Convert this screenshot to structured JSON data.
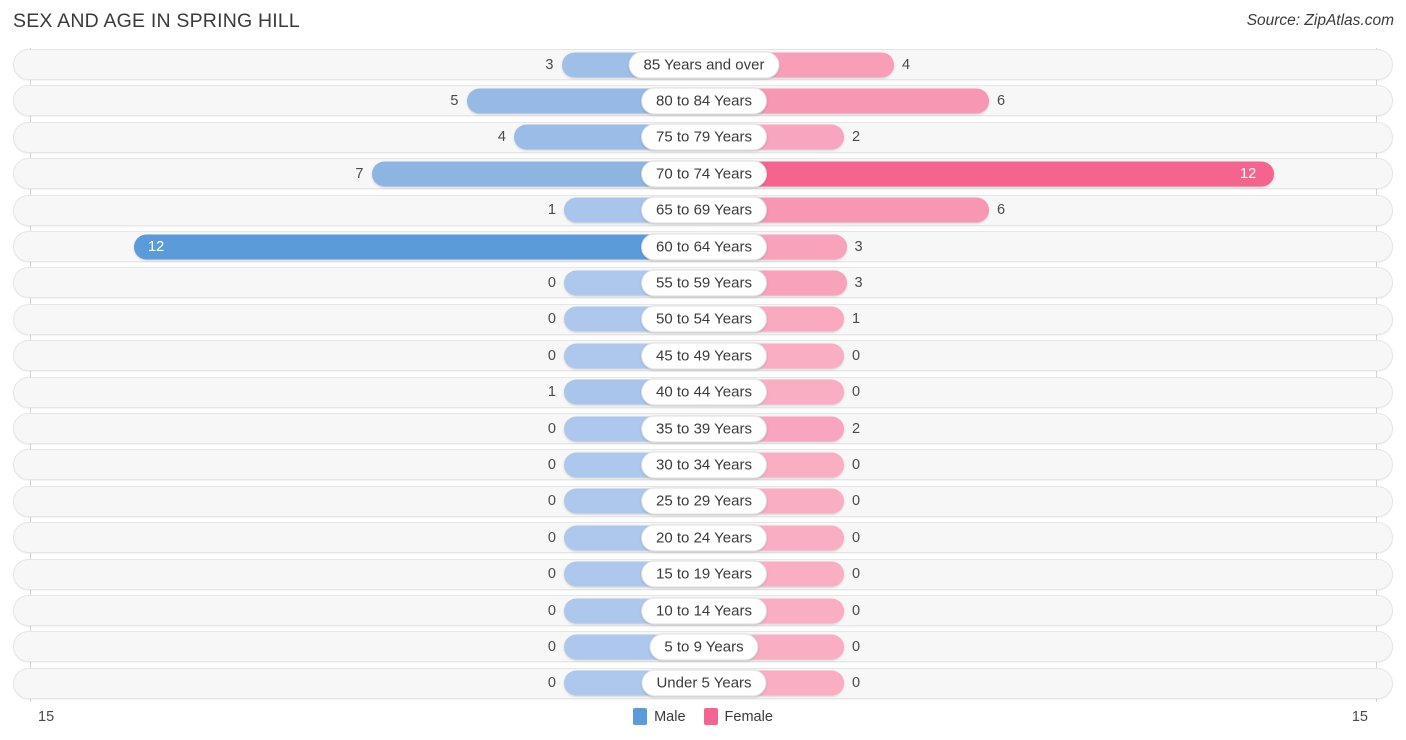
{
  "header": {
    "title": "SEX AND AGE IN SPRING HILL",
    "source": "Source: ZipAtlas.com"
  },
  "legend": {
    "male_label": "Male",
    "female_label": "Female",
    "male_color": "#5b9bd9",
    "female_color": "#f4648f"
  },
  "axis": {
    "left_label": "15",
    "right_label": "15",
    "max": 15
  },
  "chart_data": {
    "type": "bar",
    "title": "SEX AND AGE IN SPRING HILL",
    "subtitle": "Source: ZipAtlas.com",
    "orientation": "horizontal",
    "layout": "population-pyramid",
    "xlabel": "",
    "ylabel": "",
    "xlim": [
      -15,
      15
    ],
    "grid": false,
    "legend_position": "bottom-center",
    "categories": [
      "85 Years and over",
      "80 to 84 Years",
      "75 to 79 Years",
      "70 to 74 Years",
      "65 to 69 Years",
      "60 to 64 Years",
      "55 to 59 Years",
      "50 to 54 Years",
      "45 to 49 Years",
      "40 to 44 Years",
      "35 to 39 Years",
      "30 to 34 Years",
      "25 to 29 Years",
      "20 to 24 Years",
      "15 to 19 Years",
      "10 to 14 Years",
      "5 to 9 Years",
      "Under 5 Years"
    ],
    "series": [
      {
        "name": "Male",
        "side": "left",
        "color": "#5b9bd9",
        "values": [
          3,
          5,
          4,
          7,
          1,
          12,
          0,
          0,
          0,
          1,
          0,
          0,
          0,
          0,
          0,
          0,
          0,
          0
        ]
      },
      {
        "name": "Female",
        "side": "right",
        "color": "#f4648f",
        "values": [
          4,
          6,
          2,
          12,
          6,
          3,
          3,
          1,
          0,
          0,
          2,
          0,
          0,
          0,
          0,
          0,
          0,
          0
        ]
      }
    ]
  },
  "rows": [
    {
      "label": "85 Years and over",
      "male": "3",
      "female": "4"
    },
    {
      "label": "80 to 84 Years",
      "male": "5",
      "female": "6"
    },
    {
      "label": "75 to 79 Years",
      "male": "4",
      "female": "2"
    },
    {
      "label": "70 to 74 Years",
      "male": "7",
      "female": "12"
    },
    {
      "label": "65 to 69 Years",
      "male": "1",
      "female": "6"
    },
    {
      "label": "60 to 64 Years",
      "male": "12",
      "female": "3"
    },
    {
      "label": "55 to 59 Years",
      "male": "0",
      "female": "3"
    },
    {
      "label": "50 to 54 Years",
      "male": "0",
      "female": "1"
    },
    {
      "label": "45 to 49 Years",
      "male": "0",
      "female": "0"
    },
    {
      "label": "40 to 44 Years",
      "male": "1",
      "female": "0"
    },
    {
      "label": "35 to 39 Years",
      "male": "0",
      "female": "2"
    },
    {
      "label": "30 to 34 Years",
      "male": "0",
      "female": "0"
    },
    {
      "label": "25 to 29 Years",
      "male": "0",
      "female": "0"
    },
    {
      "label": "20 to 24 Years",
      "male": "0",
      "female": "0"
    },
    {
      "label": "15 to 19 Years",
      "male": "0",
      "female": "0"
    },
    {
      "label": "10 to 14 Years",
      "male": "0",
      "female": "0"
    },
    {
      "label": "5 to 9 Years",
      "male": "0",
      "female": "0"
    },
    {
      "label": "Under 5 Years",
      "male": "0",
      "female": "0"
    }
  ]
}
